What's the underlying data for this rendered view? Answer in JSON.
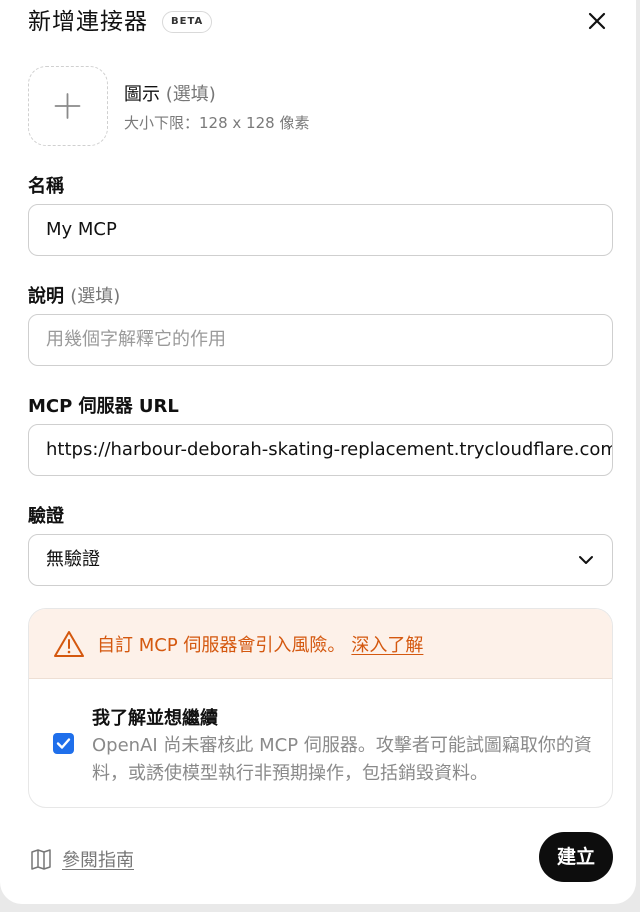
{
  "header": {
    "title": "新增連接器",
    "badge": "BETA"
  },
  "icon_field": {
    "label": "圖示",
    "optional": "(選填)",
    "hint": "大小下限：128 x 128 像素"
  },
  "name_field": {
    "label": "名稱",
    "value": "My MCP"
  },
  "description_field": {
    "label": "說明",
    "optional": "(選填)",
    "placeholder": "用幾個字解釋它的作用"
  },
  "url_field": {
    "label": "MCP 伺服器 URL",
    "value": "https://harbour-deborah-skating-replacement.trycloudflare.com"
  },
  "auth_field": {
    "label": "驗證",
    "selected": "無驗證"
  },
  "warning": {
    "text": "自訂 MCP 伺服器會引入風險。",
    "link": "深入了解",
    "ack_title": "我了解並想繼續",
    "ack_body": "OpenAI 尚未審核此 MCP 伺服器。攻擊者可能試圖竊取你的資料，或誘使模型執行非預期操作，包括銷毀資料。",
    "checked": true
  },
  "footer": {
    "guide_link": "參閱指南",
    "create_label": "建立"
  },
  "colors": {
    "warning": "#d4580f",
    "warning_bg": "#fdf1e9",
    "checkbox": "#1f6feb",
    "primary_button": "#0d0d0d"
  },
  "icons": [
    "close-icon",
    "plus-icon",
    "chevron-down-icon",
    "warning-triangle-icon",
    "checkmark-icon",
    "book-icon"
  ]
}
